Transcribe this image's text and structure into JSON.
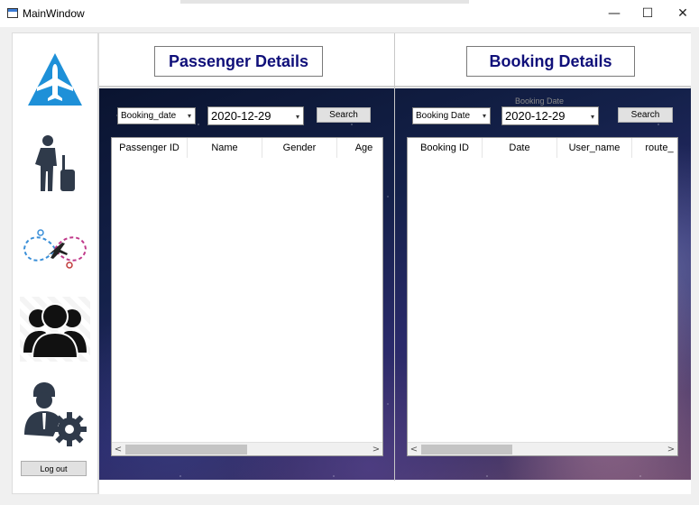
{
  "window": {
    "title": "MainWindow",
    "minimize_glyph": "—",
    "maximize_glyph": "☐",
    "close_glyph": "✕"
  },
  "sidebar": {
    "items": [
      {
        "name": "airline-logo-icon",
        "color": "#1e90d8"
      },
      {
        "name": "traveler-luggage-icon",
        "color": "#2f3a4a"
      },
      {
        "name": "flight-route-icon",
        "color": "#2a2a2a"
      },
      {
        "name": "users-group-icon",
        "color": "#111111"
      },
      {
        "name": "admin-settings-icon",
        "color": "#2f3a4a"
      }
    ],
    "logout_label": "Log out"
  },
  "passenger": {
    "header": "Passenger Details",
    "filter": "Booking_date",
    "date": "2020-12-29",
    "search_label": "Search",
    "columns": [
      "Passenger ID",
      "Name",
      "Gender",
      "Age"
    ]
  },
  "booking": {
    "header": "Booking Details",
    "field_label": "Booking Date",
    "filter": "Booking  Date",
    "date": "2020-12-29",
    "search_label": "Search",
    "columns": [
      "Booking ID",
      "Date",
      "User_name",
      "route_"
    ]
  },
  "scroll_arrows": {
    "left": "<",
    "right": ">"
  },
  "colors": {
    "header_text": "#10107a",
    "accent": "#1e90d8"
  }
}
